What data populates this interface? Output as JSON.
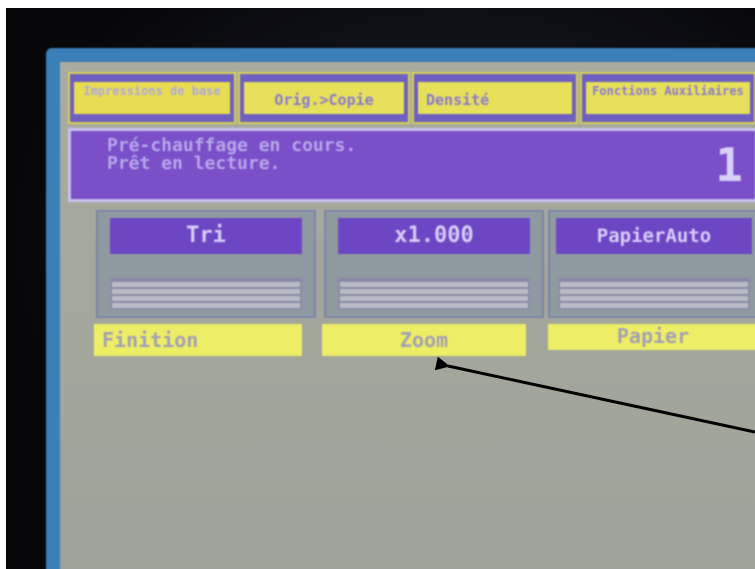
{
  "tabs": [
    {
      "label": "Impressions de base",
      "active": true
    },
    {
      "label": "Orig.>Copie",
      "active": false
    },
    {
      "label": "Densité",
      "active": false
    },
    {
      "label": "Fonctions Auxiliaires",
      "active": false
    }
  ],
  "status": {
    "message": "Pré-chauffage en cours.\nPrêt en lecture.",
    "copy_count": "1"
  },
  "settings": [
    {
      "value": "Tri",
      "label": "Finition"
    },
    {
      "value": "x1.000",
      "label": "Zoom"
    },
    {
      "value": "PapierAuto",
      "label": "Papier"
    }
  ],
  "colors": {
    "panel": "#a4a79c",
    "accent_purple": "#6d46c4",
    "label_yellow": "#eeee66",
    "frame_blue": "#3a7fb8"
  }
}
